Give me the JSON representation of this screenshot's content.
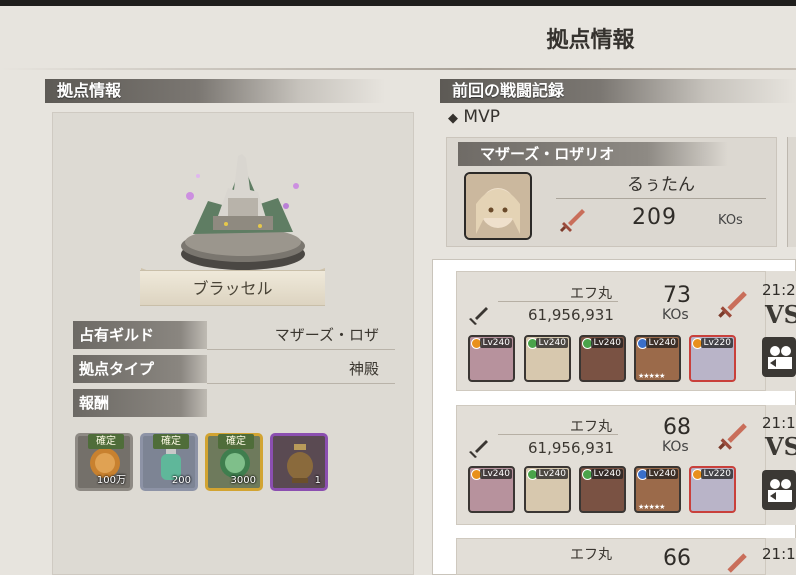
{
  "page": {
    "title": "拠点情報"
  },
  "left": {
    "section_title": "拠点情報",
    "base_name": "ブラッセル",
    "rows": [
      {
        "label": "占有ギルド",
        "value": "マザーズ・ロザ"
      },
      {
        "label": "拠点タイプ",
        "value": "神殿"
      },
      {
        "label": "報酬",
        "value": ""
      }
    ],
    "rewards": [
      {
        "tag": "確定",
        "qty": "100万",
        "icon": "coin-icon",
        "border": "#8e8a84"
      },
      {
        "tag": "確定",
        "qty": "200",
        "icon": "potion-icon",
        "border": "#8d93a6"
      },
      {
        "tag": "確定",
        "qty": "3000",
        "icon": "green-medal-icon",
        "border": "#d2a432"
      },
      {
        "tag": "",
        "qty": "1",
        "icon": "urn-icon",
        "border": "#8b4fb0"
      }
    ]
  },
  "right": {
    "section_title": "前回の戦闘記録",
    "mvp_label": "MVP",
    "mvp": {
      "guild": "マザーズ・ロザリオ",
      "player": "るぅたん",
      "kos": "209",
      "kos_unit": "KOs"
    },
    "battles": [
      {
        "enemy": "エフ丸",
        "power": "61,956,931",
        "kos": "73",
        "kos_unit": "KOs",
        "time": "21:2",
        "vs": "VS",
        "units": [
          {
            "lv": "Lv240",
            "elem": "#e8901c",
            "red": false
          },
          {
            "lv": "Lv240",
            "elem": "#4aa34a",
            "red": false
          },
          {
            "lv": "Lv240",
            "elem": "#4aa34a",
            "red": false
          },
          {
            "lv": "Lv240",
            "elem": "#3a6fc9",
            "red": false
          },
          {
            "lv": "Lv220",
            "elem": "#e8901c",
            "red": true
          }
        ]
      },
      {
        "enemy": "エフ丸",
        "power": "61,956,931",
        "kos": "68",
        "kos_unit": "KOs",
        "time": "21:1",
        "vs": "VS",
        "units": [
          {
            "lv": "Lv240",
            "elem": "#e8901c",
            "red": false
          },
          {
            "lv": "Lv240",
            "elem": "#4aa34a",
            "red": false
          },
          {
            "lv": "Lv240",
            "elem": "#4aa34a",
            "red": false
          },
          {
            "lv": "Lv240",
            "elem": "#3a6fc9",
            "red": false
          },
          {
            "lv": "Lv220",
            "elem": "#e8901c",
            "red": true
          }
        ]
      },
      {
        "enemy": "エフ丸",
        "kos": "66",
        "time": "21:1"
      }
    ]
  }
}
